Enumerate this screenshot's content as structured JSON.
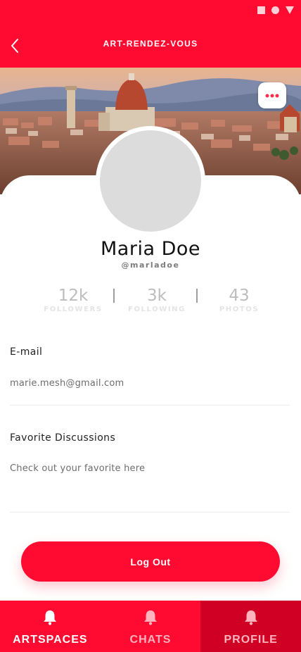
{
  "app": {
    "title": "ART-RENDEZ-VOUS"
  },
  "colors": {
    "primary": "#ff0a30",
    "primary_dark": "#d00024",
    "more_dots": "#ff2d4b"
  },
  "icons": {
    "status": [
      "square-icon",
      "circle-icon",
      "triangle-icon"
    ],
    "back": "chevron-left-icon",
    "more": "more-horizontal-icon",
    "nav": "bell-icon"
  },
  "profile": {
    "name": "Maria Doe",
    "handle": "@marladoe",
    "stats": [
      {
        "value": "12k",
        "label": "FOLLOWERS"
      },
      {
        "value": "3k",
        "label": "FOLLOWING"
      },
      {
        "value": "43",
        "label": "PHOTOS"
      }
    ]
  },
  "fields": {
    "email": {
      "label": "E-mail",
      "value": "marie.mesh@gmail.com"
    },
    "favorites": {
      "label": "Favorite Discussions",
      "value": "Check out your favorite here"
    }
  },
  "actions": {
    "logout_label": "Log Out"
  },
  "nav": {
    "active": "PROFILE",
    "items": [
      {
        "label": "ARTSPACES",
        "label_color": "#ffffff",
        "icon_color": "#ffffff"
      },
      {
        "label": "CHATS",
        "label_color": "#ffb3be",
        "icon_color": "#ffb3be"
      },
      {
        "label": "PROFILE",
        "label_color": "#ffb3be",
        "icon_color": "#ffb3be"
      }
    ]
  }
}
